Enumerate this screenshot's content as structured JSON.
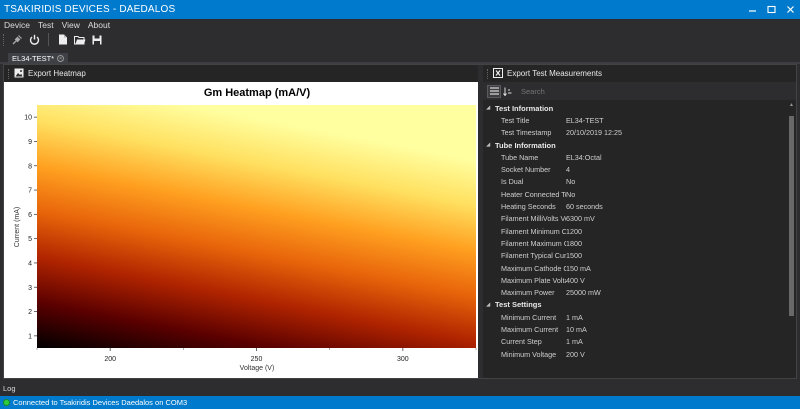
{
  "window": {
    "title": "TSAKIRIDIS DEVICES - DAEDALOS"
  },
  "menu": [
    "Device",
    "Test",
    "View",
    "About"
  ],
  "tab": {
    "label": "EL34-TEST*"
  },
  "left_pane": {
    "export_label": "Export Heatmap"
  },
  "right_pane": {
    "export_label": "Export Test Measurements",
    "search_placeholder": "Search",
    "categories": [
      {
        "title": "Test Information",
        "props": [
          {
            "name": "Test Title",
            "value": "EL34-TEST"
          },
          {
            "name": "Test Timestamp",
            "value": "20/10/2019 12:25"
          }
        ]
      },
      {
        "title": "Tube Information",
        "props": [
          {
            "name": "Tube Name",
            "value": "EL34:Octal"
          },
          {
            "name": "Socket Number",
            "value": "4"
          },
          {
            "name": "Is Dual",
            "value": "No"
          },
          {
            "name": "Heater Connected To...",
            "value": "No"
          },
          {
            "name": "Heating Seconds",
            "value": "60 seconds"
          },
          {
            "name": "Filament MilliVolts Volt...",
            "value": "6300 mV"
          },
          {
            "name": "Filament Minimum Curr...",
            "value": "1200"
          },
          {
            "name": "Filament Maximum Cu...",
            "value": "1800"
          },
          {
            "name": "Filament Typical Current",
            "value": "1500"
          },
          {
            "name": "Maximum Cathode Cu...",
            "value": "150 mA"
          },
          {
            "name": "Maximum Plate Voltage",
            "value": "400 V"
          },
          {
            "name": "Maximum Power",
            "value": "25000 mW"
          }
        ]
      },
      {
        "title": "Test Settings",
        "props": [
          {
            "name": "Minimum Current",
            "value": "1 mA"
          },
          {
            "name": "Maximum Current",
            "value": "10 mA"
          },
          {
            "name": "Current Step",
            "value": "1 mA"
          },
          {
            "name": "Minimum Voltage",
            "value": "200 V"
          }
        ]
      }
    ]
  },
  "log": {
    "label": "Log"
  },
  "status": {
    "text": "Connected to Tsakiridis Devices Daedalos on COM3"
  },
  "chart_data": {
    "type": "heatmap",
    "title": "Gm Heatmap (mA/V)",
    "xlabel": "Voltage (V)",
    "ylabel": "Current (mA)",
    "xlim": [
      175,
      325
    ],
    "ylim": [
      0.5,
      10.5
    ],
    "x_ticks": [
      200,
      250,
      300
    ],
    "y_ticks": [
      1,
      2,
      3,
      4,
      5,
      6,
      7,
      8,
      9,
      10
    ],
    "colormap": [
      "#000000",
      "#5a0000",
      "#b02400",
      "#e8640a",
      "#ffa020",
      "#ffe060",
      "#ffffa0"
    ],
    "grid": false,
    "legend": "none"
  },
  "colors": {
    "accent": "#007acc",
    "background": "#2d2d30",
    "status_ok": "#2ecc40"
  },
  "icons": [
    "minimize-icon",
    "maximize-icon",
    "close-icon",
    "connect-plug-icon",
    "power-icon",
    "new-file-icon",
    "open-folder-icon",
    "save-icon",
    "image-export-icon",
    "excel-export-icon",
    "categorized-view-icon",
    "sort-alpha-icon"
  ]
}
